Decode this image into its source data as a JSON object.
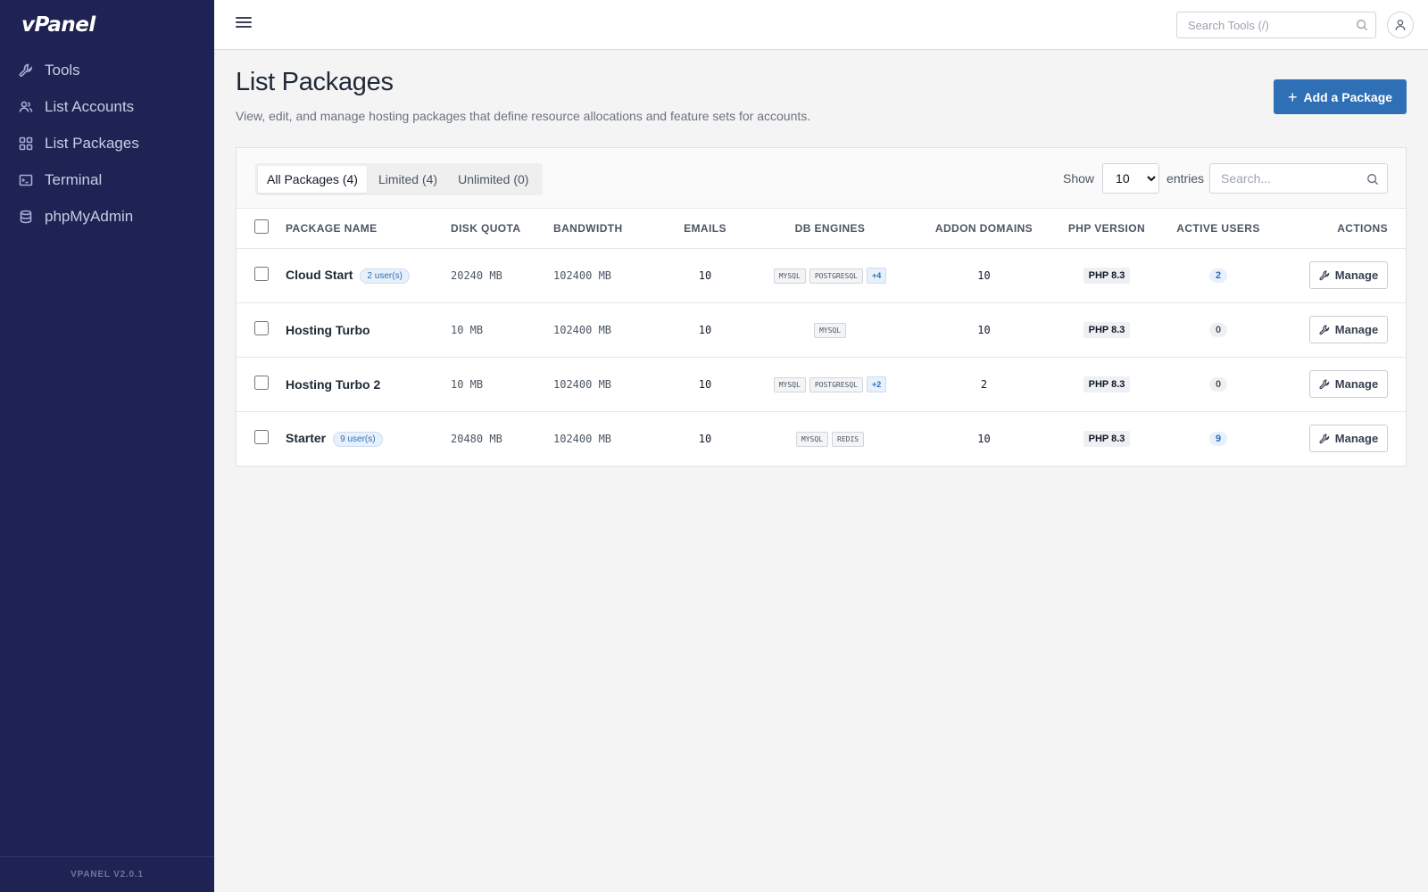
{
  "sidebar": {
    "brand": "vPanel",
    "items": [
      {
        "label": "Tools",
        "icon": "wrench-icon"
      },
      {
        "label": "List Accounts",
        "icon": "users-icon"
      },
      {
        "label": "List Packages",
        "icon": "grid-icon"
      },
      {
        "label": "Terminal",
        "icon": "terminal-icon"
      },
      {
        "label": "phpMyAdmin",
        "icon": "database-icon"
      }
    ],
    "version": "VPANEL V2.0.1"
  },
  "topbar": {
    "search_placeholder": "Search Tools (/)"
  },
  "page": {
    "title": "List Packages",
    "subtitle": "View, edit, and manage hosting packages that define resource allocations and feature sets for accounts.",
    "add_button": "Add a Package"
  },
  "filters": {
    "tabs": [
      "All Packages (4)",
      "Limited (4)",
      "Unlimited (0)"
    ],
    "active_tab": "All Packages (4)",
    "show_label": "Show",
    "entries_value": "10",
    "entries_label": "entries",
    "search_placeholder": "Search..."
  },
  "table": {
    "columns": [
      "PACKAGE NAME",
      "DISK QUOTA",
      "BANDWIDTH",
      "EMAILS",
      "DB ENGINES",
      "ADDON DOMAINS",
      "PHP VERSION",
      "ACTIVE USERS",
      "ACTIONS"
    ],
    "rows": [
      {
        "name": "Cloud Start",
        "users_badge": "2 user(s)",
        "disk": "20240 MB",
        "bandwidth": "102400 MB",
        "emails": "10",
        "db_engines": [
          "MYSQL",
          "POSTGRESQL"
        ],
        "db_more": "+4",
        "addon_domains": "10",
        "php": "PHP 8.3",
        "active_users": "2",
        "action": "Manage"
      },
      {
        "name": "Hosting Turbo",
        "users_badge": "",
        "disk": "10 MB",
        "bandwidth": "102400 MB",
        "emails": "10",
        "db_engines": [
          "MYSQL"
        ],
        "db_more": "",
        "addon_domains": "10",
        "php": "PHP 8.3",
        "active_users": "0",
        "action": "Manage"
      },
      {
        "name": "Hosting Turbo 2",
        "users_badge": "",
        "disk": "10 MB",
        "bandwidth": "102400 MB",
        "emails": "10",
        "db_engines": [
          "MYSQL",
          "POSTGRESQL"
        ],
        "db_more": "+2",
        "addon_domains": "2",
        "php": "PHP 8.3",
        "active_users": "0",
        "action": "Manage"
      },
      {
        "name": "Starter",
        "users_badge": "9 user(s)",
        "disk": "20480 MB",
        "bandwidth": "102400 MB",
        "emails": "10",
        "db_engines": [
          "MYSQL",
          "REDIS"
        ],
        "db_more": "",
        "addon_domains": "10",
        "php": "PHP 8.3",
        "active_users": "9",
        "action": "Manage"
      }
    ]
  }
}
